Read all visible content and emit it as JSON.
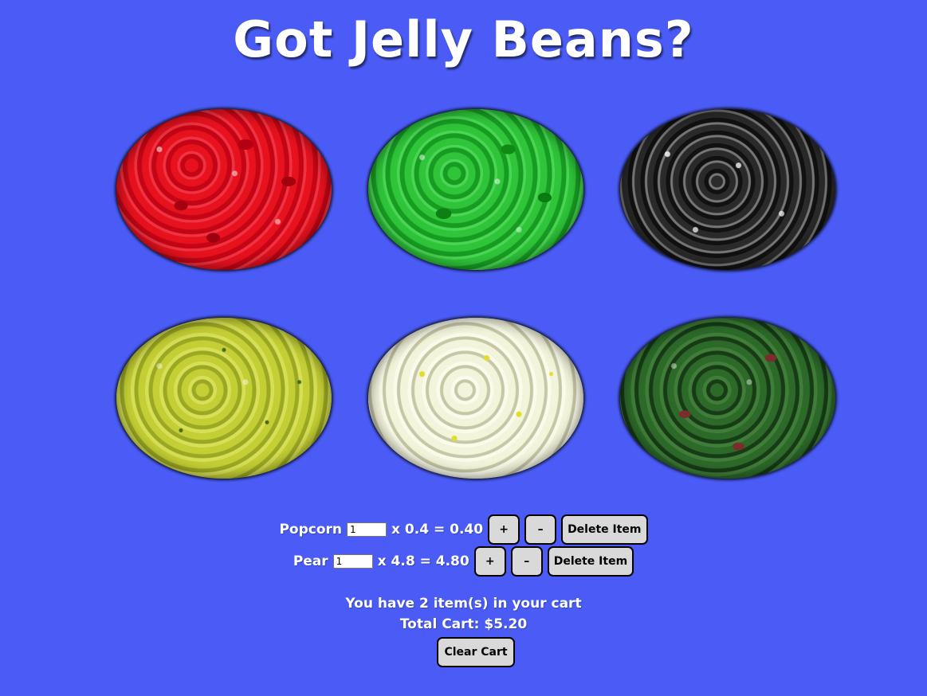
{
  "title": "Got Jelly Beans?",
  "beans": [
    {
      "flavor": "red-icon",
      "color": "#d50f1c"
    },
    {
      "flavor": "green-icon",
      "color": "#22b12d"
    },
    {
      "flavor": "black-icon",
      "color": "#3a3a3a"
    },
    {
      "flavor": "pear-icon",
      "color": "#b7c22c"
    },
    {
      "flavor": "popcorn-icon",
      "color": "#eceed0"
    },
    {
      "flavor": "watermelon-icon",
      "color": "#255c22"
    }
  ],
  "cart": {
    "items": [
      {
        "name": "Popcorn",
        "quantity": "1",
        "price_text": "x 0.4 = 0.40",
        "plus_label": "+",
        "minus_label": "–",
        "delete_label": "Delete Item"
      },
      {
        "name": "Pear",
        "quantity": "1",
        "price_text": "x 4.8 = 4.80",
        "plus_label": "+",
        "minus_label": "–",
        "delete_label": "Delete Item"
      }
    ],
    "summary": "You have 2 item(s) in your cart",
    "total": "Total Cart: $5.20",
    "clear_label": "Clear Cart"
  },
  "colors": {
    "background": "#4a5cf5",
    "button": "#d9d9d9"
  }
}
